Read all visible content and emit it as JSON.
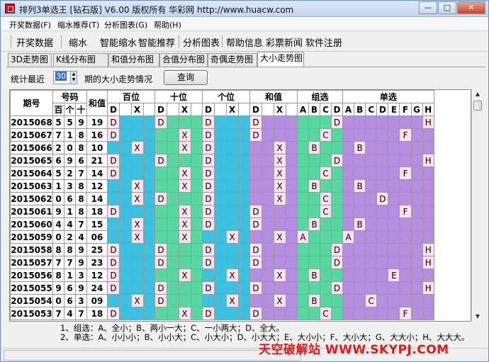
{
  "window": {
    "title": "排列3单选王 [钻石版] V6.00  版权所有 华彩网 http://www.huacw.com",
    "minimize": "—",
    "maximize": "□",
    "close": "✕"
  },
  "menu": [
    "开奖数据(F)",
    "缩水推荐(T)",
    "分析图表(G)",
    "帮助(H)"
  ],
  "toolbar": [
    "开奖数据",
    "缩水",
    "智能缩水",
    "智能推荐",
    "分析图表",
    "帮助信息",
    "彩票新闻",
    "软件注册"
  ],
  "tabs": [
    "3D走势图",
    "K线分布图",
    "和值分布图",
    "合值分布图",
    "奇偶走势图",
    "大小走势图"
  ],
  "active_tab": 5,
  "stats": {
    "label_before": "统计最近",
    "periods": "30",
    "label_after": "期的大小走势情况",
    "query_button": "查询"
  },
  "table": {
    "headers": {
      "issue": "期号",
      "numbers": "号码",
      "digits": [
        "百",
        "个",
        "十"
      ],
      "sum": "和值",
      "hundreds": "百位",
      "tens": "十位",
      "units": "个位",
      "sum_group": "和值",
      "group_sel": "组选",
      "single_sel": "单选"
    },
    "dx": [
      "D",
      "X"
    ],
    "group_letters": [
      "A",
      "B",
      "C",
      "D"
    ],
    "single_letters": [
      "A",
      "B",
      "C",
      "D",
      "E",
      "F",
      "G",
      "H"
    ],
    "rows": [
      {
        "issue": "2015068",
        "n": [
          "5",
          "5",
          "9"
        ],
        "sum": "19",
        "h": "D",
        "t": "D",
        "u": "D",
        "s": "D",
        "g": "D",
        "single": "H"
      },
      {
        "issue": "2015067",
        "n": [
          "7",
          "1",
          "8"
        ],
        "sum": "16",
        "h": "D",
        "t": "X",
        "u": "D",
        "s": "D",
        "g": "C",
        "single": "F"
      },
      {
        "issue": "2015066",
        "n": [
          "2",
          "0",
          "8"
        ],
        "sum": "10",
        "h": "X",
        "t": "X",
        "u": "D",
        "s": "X",
        "g": "B",
        "single": "B"
      },
      {
        "issue": "2015065",
        "n": [
          "6",
          "9",
          "6"
        ],
        "sum": "21",
        "h": "D",
        "t": "D",
        "u": "D",
        "s": "X",
        "g": "D",
        "single": "H"
      },
      {
        "issue": "2015064",
        "n": [
          "5",
          "2",
          "7"
        ],
        "sum": "14",
        "h": "D",
        "t": "X",
        "u": "D",
        "s": "X",
        "g": "C",
        "single": "F"
      },
      {
        "issue": "2015063",
        "n": [
          "1",
          "3",
          "8"
        ],
        "sum": "12",
        "h": "X",
        "t": "X",
        "u": "D",
        "s": "X",
        "g": "B",
        "single": "B"
      },
      {
        "issue": "2015062",
        "n": [
          "0",
          "6",
          "8"
        ],
        "sum": "14",
        "h": "X",
        "t": "D",
        "u": "D",
        "s": "X",
        "g": "C",
        "single": "D"
      },
      {
        "issue": "2015061",
        "n": [
          "9",
          "1",
          "8"
        ],
        "sum": "18",
        "h": "D",
        "t": "X",
        "u": "D",
        "s": "D",
        "g": "C",
        "single": "F"
      },
      {
        "issue": "2015060",
        "n": [
          "4",
          "4",
          "7"
        ],
        "sum": "15",
        "h": "X",
        "t": "X",
        "u": "D",
        "s": "D",
        "g": "B",
        "single": "B"
      },
      {
        "issue": "2015059",
        "n": [
          "0",
          "2",
          "4"
        ],
        "sum": "06",
        "h": "X",
        "t": "X",
        "u": "X",
        "s": "X",
        "g": "A",
        "single": "A"
      },
      {
        "issue": "2015058",
        "n": [
          "8",
          "8",
          "9"
        ],
        "sum": "25",
        "h": "D",
        "t": "D",
        "u": "D",
        "s": "D",
        "g": "D",
        "single": "H"
      },
      {
        "issue": "2015057",
        "n": [
          "7",
          "7",
          "9"
        ],
        "sum": "23",
        "h": "D",
        "t": "D",
        "u": "D",
        "s": "D",
        "g": "D",
        "single": "H"
      },
      {
        "issue": "2015056",
        "n": [
          "8",
          "1",
          "3"
        ],
        "sum": "12",
        "h": "D",
        "t": "X",
        "u": "X",
        "s": "X",
        "g": "B",
        "single": "E"
      },
      {
        "issue": "2015055",
        "n": [
          "9",
          "6",
          "9"
        ],
        "sum": "24",
        "h": "D",
        "t": "D",
        "u": "D",
        "s": "D",
        "g": "D",
        "single": "H"
      },
      {
        "issue": "2015054",
        "n": [
          "0",
          "6",
          "3"
        ],
        "sum": "09",
        "h": "X",
        "t": "D",
        "u": "X",
        "s": "X",
        "g": "B",
        "single": "C"
      },
      {
        "issue": "2015053",
        "n": [
          "7",
          "4",
          "7"
        ],
        "sum": "18",
        "h": "D",
        "t": "X",
        "u": "D",
        "s": "D",
        "g": "C",
        "single": "F"
      }
    ]
  },
  "notes": [
    "1、组选：A、全小；B、两小一大；C、一小两大；D、全大。",
    "2、单选：A、小小小；B、小小大；C、小大小；D、小大大；E、大小小；F、大小大；G、大大小；H、大大大。"
  ],
  "watermark": "天空破解站 WWW.SKYPJ.COM",
  "colors": {
    "pos_blue": "#3ec0e0",
    "pos_green": "#5ad6a0",
    "purple": "#b58ee0",
    "mark_pink": "#ffe2ee",
    "watermark_red": "#e0191b"
  }
}
